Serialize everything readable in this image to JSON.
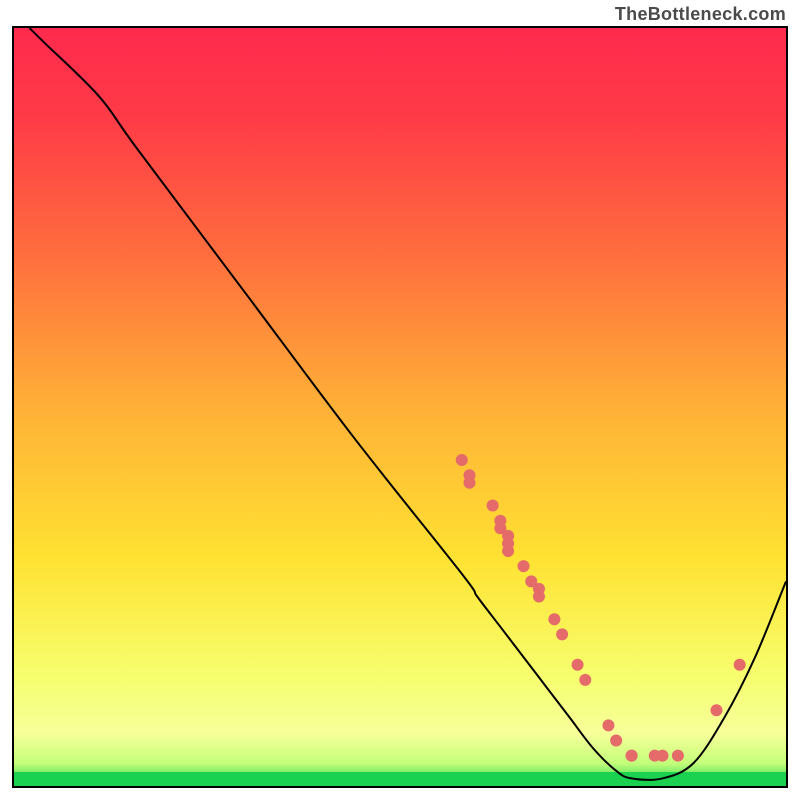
{
  "attribution": "TheBottleneck.com",
  "chart_data": {
    "type": "line",
    "title": "",
    "xlabel": "",
    "ylabel": "",
    "xlim": [
      0,
      100
    ],
    "ylim": [
      0,
      100
    ],
    "grid": false,
    "legend": false,
    "background_gradient": {
      "top": "#ff2a4d",
      "middle": "#ffe232",
      "bottom_band": "#f7ff9a",
      "baseline": "#1ad24f"
    },
    "curve": {
      "name": "bottleneck-curve",
      "color": "#000000",
      "points": [
        {
          "x": 2,
          "y": 100
        },
        {
          "x": 4,
          "y": 98
        },
        {
          "x": 11,
          "y": 91
        },
        {
          "x": 16,
          "y": 84
        },
        {
          "x": 30,
          "y": 65
        },
        {
          "x": 44,
          "y": 46
        },
        {
          "x": 58,
          "y": 28
        },
        {
          "x": 60,
          "y": 25
        },
        {
          "x": 63,
          "y": 21
        },
        {
          "x": 66,
          "y": 17
        },
        {
          "x": 69,
          "y": 13
        },
        {
          "x": 72,
          "y": 9
        },
        {
          "x": 75,
          "y": 5
        },
        {
          "x": 78,
          "y": 2
        },
        {
          "x": 80,
          "y": 1
        },
        {
          "x": 84,
          "y": 1
        },
        {
          "x": 88,
          "y": 3
        },
        {
          "x": 92,
          "y": 9
        },
        {
          "x": 96,
          "y": 17
        },
        {
          "x": 100,
          "y": 27
        }
      ]
    },
    "scatter": {
      "name": "highlighted-points",
      "color": "#e56a6a",
      "radius": 6,
      "points": [
        {
          "x": 58,
          "y": 43
        },
        {
          "x": 59,
          "y": 40
        },
        {
          "x": 59,
          "y": 41
        },
        {
          "x": 62,
          "y": 37
        },
        {
          "x": 63,
          "y": 35
        },
        {
          "x": 63,
          "y": 34
        },
        {
          "x": 64,
          "y": 33
        },
        {
          "x": 64,
          "y": 32
        },
        {
          "x": 64,
          "y": 31
        },
        {
          "x": 66,
          "y": 29
        },
        {
          "x": 67,
          "y": 27
        },
        {
          "x": 68,
          "y": 26
        },
        {
          "x": 68,
          "y": 25
        },
        {
          "x": 70,
          "y": 22
        },
        {
          "x": 71,
          "y": 20
        },
        {
          "x": 73,
          "y": 16
        },
        {
          "x": 74,
          "y": 14
        },
        {
          "x": 77,
          "y": 8
        },
        {
          "x": 78,
          "y": 6
        },
        {
          "x": 80,
          "y": 4
        },
        {
          "x": 80,
          "y": 4
        },
        {
          "x": 83,
          "y": 4
        },
        {
          "x": 84,
          "y": 4
        },
        {
          "x": 86,
          "y": 4
        },
        {
          "x": 91,
          "y": 10
        },
        {
          "x": 94,
          "y": 16
        }
      ]
    }
  }
}
